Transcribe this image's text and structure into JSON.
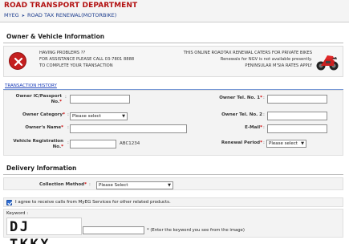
{
  "header": {
    "title": "ROAD TRANSPORT DEPARTMENT",
    "breadcrumb": [
      "MYEG",
      "ROAD TAX RENEWAL(MOTORBIKE)"
    ]
  },
  "owner_section": {
    "title": "Owner & Vehicle Information"
  },
  "notice": {
    "left_lines": [
      "HAVING PROBLEMS ??",
      "FOR ASSISTANCE PLEASE CALL 03-7801 8888",
      "TO COMPLETE YOUR TRANSACTION"
    ],
    "right_lines": [
      "THIS ONLINE ROADTAX RENEWAL CATERS FOR PRIVATE BIKES",
      "Renewals for NGV is not available presently.",
      "PENINSULAR M'SIA RATES APPLY"
    ],
    "icon": "alert-icon",
    "image": "motorbike-icon"
  },
  "transaction_history": {
    "label": "TRANSACTION HISTORY"
  },
  "form": {
    "owner_ic_label_1": "Owner IC/Passport",
    "owner_ic_label_2": "No.",
    "owner_ic_value": "",
    "owner_tel1_label": "Owner Tel. No. 1",
    "owner_tel1_value": "",
    "owner_category_label": "Owner Category",
    "owner_category_selected": "Please select",
    "owner_tel2_label": "Owner Tel. No. 2",
    "owner_tel2_value": "",
    "owner_name_label": "Owner's Name",
    "owner_name_value": "",
    "email_label": "E-Mail",
    "email_value": "",
    "vehicle_reg_label_1": "Vehicle Registration",
    "vehicle_reg_label_2": "No.",
    "vehicle_reg_value": "ABC1234",
    "renewal_period_label": "Renewal Period",
    "renewal_period_selected": "Please select"
  },
  "delivery_section": {
    "title": "Delivery Information",
    "collection_method_label": "Collection Method",
    "collection_method_selected": "Please Select"
  },
  "agreement": {
    "checked": true,
    "text": "I agree to receive calls from MyEG Services for other related products."
  },
  "keyword": {
    "label": "Keyword :",
    "captcha_text": "DJ TKKX",
    "value": "",
    "hint": "* (Enter the keyword you see from the image)"
  },
  "colors": {
    "title_red": "#b31212",
    "link_blue": "#1a3db8",
    "required_red": "#cc0000",
    "alert_red": "#c41f1f",
    "checkbox_blue": "#2f6fd6"
  }
}
